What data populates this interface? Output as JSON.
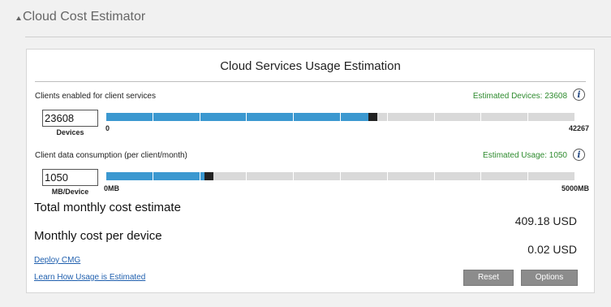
{
  "section": {
    "title": "Cloud Cost Estimator"
  },
  "panel": {
    "title": "Cloud Services Usage Estimation"
  },
  "clients": {
    "label": "Clients enabled for client services",
    "estimate_text": "Estimated Devices: 23608",
    "input_value": "23608",
    "unit": "Devices",
    "min_label": "0",
    "max_label": "42267",
    "slider_fraction": 0.56
  },
  "data": {
    "label": "Client data consumption (per client/month)",
    "estimate_text": "Estimated Usage: 1050",
    "input_value": "1050",
    "unit": "MB/Device",
    "min_label": "0MB",
    "max_label": "5000MB",
    "slider_fraction": 0.21
  },
  "costs": {
    "total_label": "Total monthly cost estimate",
    "total_value": "409.18 USD",
    "per_device_label": "Monthly cost per device",
    "per_device_value": "0.02 USD"
  },
  "links": {
    "deploy": "Deploy CMG",
    "learn": "Learn How Usage is Estimated"
  },
  "buttons": {
    "reset": "Reset",
    "options": "Options"
  },
  "icons": {
    "info": "i"
  },
  "colors": {
    "accent": "#3b98d0",
    "estimate_green": "#2e8b2e",
    "link_blue": "#1f5fae",
    "button_gray": "#8c8c8c"
  }
}
